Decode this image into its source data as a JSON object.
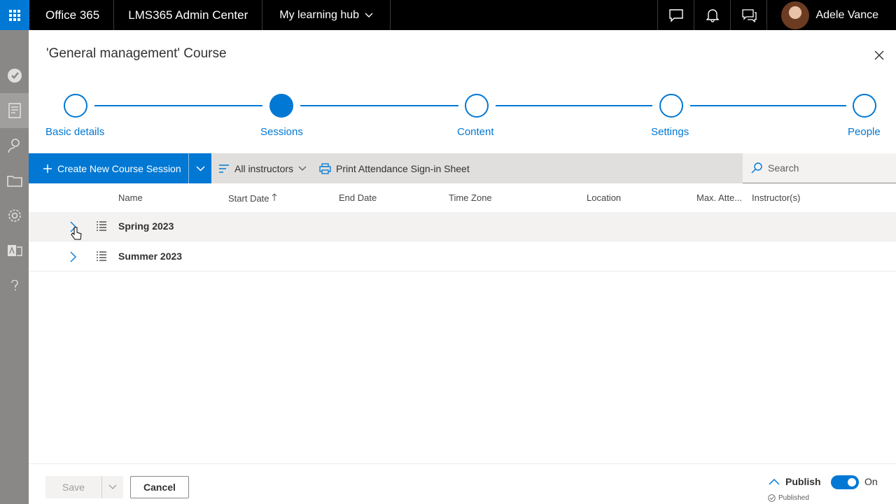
{
  "topbar": {
    "brand": "Office 365",
    "app_name": "LMS365 Admin Center",
    "hub": "My learning hub",
    "user_name": "Adele Vance",
    "icons": [
      "chat-icon",
      "bell-icon",
      "feedback-icon"
    ]
  },
  "rail": {
    "items": [
      "lms-logo-icon",
      "catalog-icon",
      "users-icon",
      "folder-icon",
      "settings-icon",
      "translate-icon",
      "help-icon"
    ],
    "active": "catalog-icon"
  },
  "panel": {
    "title": "'General management' Course"
  },
  "stepper": {
    "steps": [
      {
        "label": "Basic details",
        "state": "done"
      },
      {
        "label": "Sessions",
        "state": "current"
      },
      {
        "label": "Content",
        "state": "todo"
      },
      {
        "label": "Settings",
        "state": "todo"
      },
      {
        "label": "People",
        "state": "todo"
      }
    ],
    "accent": "#0078d4"
  },
  "commandbar": {
    "create_label": "Create New Course Session",
    "filter_label": "All instructors",
    "print_label": "Print Attendance Sign-in Sheet",
    "search_placeholder": "Search"
  },
  "table": {
    "columns": [
      "Name",
      "Start Date",
      "End Date",
      "Time Zone",
      "Location",
      "Max. Atte...",
      "Instructor(s)"
    ],
    "sort_column": "Start Date",
    "rows": [
      {
        "name": "Spring 2023"
      },
      {
        "name": "Summer 2023"
      }
    ]
  },
  "footer": {
    "save_label": "Save",
    "cancel_label": "Cancel",
    "publish_label": "Publish",
    "published_label": "Published",
    "toggle_label": "On",
    "toggle_on": true
  }
}
